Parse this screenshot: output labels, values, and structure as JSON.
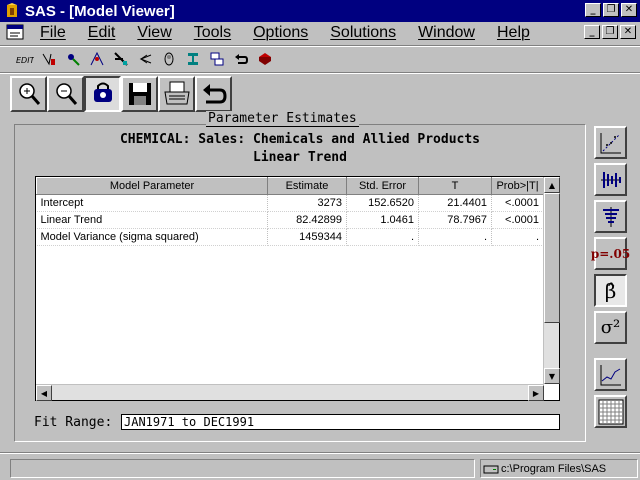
{
  "window": {
    "title": "SAS - [Model Viewer]"
  },
  "menu": [
    "File",
    "Edit",
    "View",
    "Tools",
    "Options",
    "Solutions",
    "Window",
    "Help"
  ],
  "toolbar": {
    "small_icons": [
      "edit-icon",
      "program-editor-icon",
      "explorer-icon",
      "results-icon",
      "submit-icon",
      "recall-icon",
      "library-icon",
      "options-icon",
      "tile-icon",
      "undo-icon",
      "help-book-icon"
    ],
    "large_icons": [
      "zoom-in-icon",
      "zoom-out-icon",
      "link-icon",
      "save-icon",
      "print-icon",
      "return-icon"
    ]
  },
  "report": {
    "panel_title": "Parameter Estimates",
    "series_title": "CHEMICAL: Sales: Chemicals and Allied Products",
    "model_name": "Linear Trend",
    "columns": [
      "Model Parameter",
      "Estimate",
      "Std. Error",
      "T",
      "Prob>|T|"
    ],
    "rows": [
      {
        "parameter": "Intercept",
        "estimate": "3273",
        "std_error": "152.6520",
        "t": "21.4401",
        "prob": "<.0001"
      },
      {
        "parameter": "Linear Trend",
        "estimate": "82.42899",
        "std_error": "1.0461",
        "t": "78.7967",
        "prob": "<.0001"
      },
      {
        "parameter": "Model Variance (sigma squared)",
        "estimate": "1459344",
        "std_error": ".",
        "t": ".",
        "prob": "."
      }
    ],
    "fit_range_label": "Fit Range:",
    "fit_range_value": "JAN1971 to DEC1991"
  },
  "sidebar": {
    "buttons": [
      "residual-plot-icon",
      "autocorrelation-icon",
      "white-noise-icon",
      "p-value-icon",
      "parameter-estimates-icon",
      "statistics-icon",
      "forecast-plot-icon",
      "data-table-icon"
    ],
    "p_value_label": "p=.05",
    "beta_label": "β̂",
    "sigma_label": "σ²"
  },
  "status": {
    "path": "c:\\Program Files\\SAS"
  }
}
